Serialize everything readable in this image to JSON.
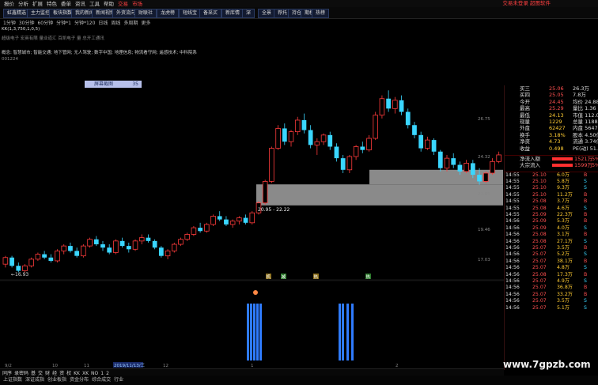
{
  "menu": {
    "items": [
      "报价",
      "分析",
      "扩展",
      "特色",
      "委单",
      "资讯",
      "工具",
      "帮助"
    ],
    "extra": [
      "交易",
      "市场"
    ],
    "right": "交易未登录 超图软件"
  },
  "toolbar": {
    "buttons": [
      "虹鑫精选",
      "主力监控",
      "板块指数",
      "我的新闻",
      "新闻视频",
      "外资流向",
      "财联社",
      "龙虎榜",
      "短线宝",
      "备采买",
      "新库情",
      "深",
      "全景",
      "荐托",
      "持仓",
      "期权",
      "热榜"
    ]
  },
  "tabs": {
    "items": [
      "1分钟",
      "30分钟",
      "60分钟",
      "分钟*1",
      "分钟*120",
      "日线",
      "周线",
      "多周期",
      "更多"
    ]
  },
  "info": {
    "line1": "KK(1,3,750,1,0,5)",
    "line2": "超级电子 宏英有限 量业道汇 百凯电子 量 总开工通讯",
    "line3": "概念: 智慧城市; 智能交通; 地下管网; 无人驾驶; 数字中国; 地理信息; 物流看守网; 遥感技术; 中科院系",
    "line4": "001224"
  },
  "badge": {
    "label": "屏幕截图",
    "value": "35"
  },
  "chart": {
    "annotations": {
      "low_label": "16.93",
      "range_label": "20.95 - 22.22"
    },
    "yaxis_right": [
      "26.75",
      "24.32",
      "21.89",
      "19.46",
      "17.03"
    ],
    "signals": [
      "机",
      "减",
      "热",
      "热"
    ],
    "volume_axis": [
      "75.00",
      "60.00",
      "45.00",
      "30.00",
      "15.00"
    ],
    "date_label": "2019/11/13/三",
    "ticks": [
      "9/2",
      "10",
      "11",
      "12",
      "1",
      "2"
    ]
  },
  "chart_data": {
    "type": "candlestick",
    "candles": [
      [
        17.4,
        17.9,
        17.2,
        17.8
      ],
      [
        17.8,
        17.9,
        17.2,
        17.3
      ],
      [
        17.3,
        17.5,
        16.9,
        17.0
      ],
      [
        17.0,
        17.4,
        16.9,
        17.3
      ],
      [
        17.3,
        17.8,
        17.2,
        17.7
      ],
      [
        17.7,
        18.1,
        17.6,
        18.0
      ],
      [
        18.0,
        18.2,
        17.7,
        17.8
      ],
      [
        17.8,
        18.0,
        17.5,
        17.6
      ],
      [
        17.6,
        18.3,
        17.5,
        18.2
      ],
      [
        18.2,
        18.6,
        18.0,
        18.5
      ],
      [
        18.5,
        18.7,
        18.1,
        18.2
      ],
      [
        18.2,
        18.4,
        17.8,
        17.9
      ],
      [
        17.9,
        18.6,
        17.8,
        18.5
      ],
      [
        18.5,
        19.0,
        18.4,
        18.9
      ],
      [
        18.9,
        19.1,
        18.5,
        18.6
      ],
      [
        18.6,
        18.8,
        18.2,
        18.4
      ],
      [
        18.4,
        18.6,
        18.0,
        18.1
      ],
      [
        18.1,
        18.9,
        18.0,
        18.8
      ],
      [
        18.8,
        19.0,
        18.4,
        18.5
      ],
      [
        18.5,
        18.7,
        18.1,
        18.3
      ],
      [
        18.3,
        18.9,
        18.2,
        18.8
      ],
      [
        18.8,
        19.2,
        18.6,
        19.0
      ],
      [
        19.0,
        19.2,
        18.7,
        18.8
      ],
      [
        18.8,
        18.9,
        18.3,
        18.4
      ],
      [
        18.4,
        18.5,
        17.8,
        17.9
      ],
      [
        17.9,
        18.3,
        17.7,
        18.2
      ],
      [
        18.2,
        18.7,
        18.1,
        18.6
      ],
      [
        18.6,
        19.0,
        18.5,
        18.9
      ],
      [
        18.9,
        19.3,
        18.8,
        19.2
      ],
      [
        19.2,
        19.7,
        19.1,
        19.6
      ],
      [
        19.6,
        19.9,
        19.3,
        19.4
      ],
      [
        19.4,
        19.9,
        19.3,
        19.8
      ],
      [
        19.8,
        20.4,
        19.7,
        20.3
      ],
      [
        20.3,
        20.6,
        20.0,
        20.1
      ],
      [
        20.1,
        20.3,
        19.7,
        19.8
      ],
      [
        19.8,
        20.1,
        19.6,
        20.0
      ],
      [
        20.0,
        20.3,
        19.8,
        20.2
      ],
      [
        20.2,
        20.4,
        19.8,
        19.9
      ],
      [
        19.9,
        20.6,
        19.8,
        20.5
      ],
      [
        20.5,
        21.2,
        20.4,
        21.1
      ],
      [
        21.1,
        22.5,
        21.0,
        22.4
      ],
      [
        22.4,
        24.5,
        22.3,
        24.4
      ],
      [
        24.4,
        25.8,
        24.3,
        25.6
      ],
      [
        25.6,
        25.9,
        24.6,
        24.8
      ],
      [
        24.8,
        25.5,
        24.5,
        25.4
      ],
      [
        25.4,
        26.3,
        25.2,
        26.1
      ],
      [
        26.1,
        26.5,
        25.3,
        25.5
      ],
      [
        25.5,
        25.8,
        24.4,
        24.6
      ],
      [
        24.6,
        25.0,
        24.0,
        24.8
      ],
      [
        24.8,
        25.3,
        24.6,
        25.2
      ],
      [
        25.2,
        25.4,
        24.3,
        24.5
      ],
      [
        24.5,
        24.7,
        23.6,
        23.8
      ],
      [
        23.8,
        24.0,
        22.9,
        23.1
      ],
      [
        23.1,
        24.0,
        22.9,
        23.9
      ],
      [
        23.9,
        24.6,
        23.7,
        24.5
      ],
      [
        24.5,
        24.8,
        24.1,
        24.3
      ],
      [
        24.3,
        25.2,
        24.2,
        25.0
      ],
      [
        25.0,
        26.6,
        24.9,
        26.4
      ],
      [
        26.4,
        27.6,
        26.2,
        27.4
      ],
      [
        27.4,
        27.9,
        26.6,
        26.8
      ],
      [
        26.8,
        27.5,
        26.5,
        27.3
      ],
      [
        27.3,
        27.6,
        26.4,
        26.6
      ],
      [
        26.6,
        26.8,
        25.6,
        25.8
      ],
      [
        25.8,
        26.0,
        25.0,
        25.2
      ],
      [
        25.2,
        25.4,
        24.2,
        24.4
      ],
      [
        24.4,
        25.1,
        24.3,
        24.9
      ],
      [
        24.9,
        25.0,
        24.0,
        24.2
      ],
      [
        24.2,
        24.3,
        23.0,
        23.2
      ],
      [
        23.2,
        24.0,
        23.0,
        23.8
      ],
      [
        23.8,
        24.1,
        23.2,
        23.4
      ],
      [
        23.4,
        23.6,
        22.8,
        23.0
      ],
      [
        23.0,
        23.7,
        22.9,
        23.5
      ],
      [
        23.5,
        23.7,
        22.6,
        22.8
      ],
      [
        22.8,
        23.2,
        22.2,
        22.4
      ],
      [
        22.4,
        23.0,
        22.3,
        22.9
      ],
      [
        22.9,
        23.8,
        22.8,
        23.6
      ],
      [
        23.6,
        24.2,
        23.5,
        24.0
      ]
    ],
    "yrange": [
      16.5,
      28.2
    ],
    "volume": [
      0,
      0,
      0,
      0,
      0,
      0,
      0,
      0,
      0,
      0,
      0,
      0,
      0,
      0,
      0,
      0,
      0,
      0,
      0,
      0,
      0,
      0,
      0,
      0,
      0,
      0,
      0,
      0,
      0,
      0,
      0,
      0,
      0,
      0,
      0,
      0,
      0,
      0,
      0,
      0,
      0,
      0,
      0,
      0,
      0,
      0,
      0,
      0,
      0,
      0,
      0,
      0,
      0,
      0,
      0,
      0,
      0,
      0,
      0,
      0,
      0,
      0,
      0,
      0,
      0,
      0,
      0,
      0,
      0,
      0,
      0,
      0,
      0,
      0,
      0,
      0,
      0
    ],
    "volume_bars_visible": [
      [
        312,
        316,
        320,
        324,
        328
      ],
      [
        428,
        432,
        438,
        444
      ]
    ]
  },
  "quote": {
    "rows": [
      [
        "买三",
        "25.06",
        "26.3万"
      ],
      [
        "买四",
        "25.05",
        "7.8万"
      ],
      [
        "今开",
        "24.45",
        "均价 24.88"
      ],
      [
        "最高",
        "25.29",
        "量比 1.36"
      ],
      [
        "最低",
        "24.13",
        "市值 112.0亿"
      ],
      [
        "现量",
        "1229",
        "总量 118898"
      ],
      [
        "外盘",
        "62427",
        "内盘 56471"
      ],
      [
        "换手",
        "3.18%",
        "股本 4.50亿"
      ],
      [
        "净资",
        "4.73",
        "流通 3.74亿"
      ],
      [
        "收益",
        "0.498",
        "PE(动) 51.1"
      ]
    ],
    "flow": [
      [
        "净流入额",
        "1521万",
        "5%"
      ],
      [
        "大宗流入",
        "1599万",
        "5%"
      ]
    ]
  },
  "ticks_list": [
    [
      "14:55",
      "25.10",
      "6.0万",
      "B"
    ],
    [
      "14:55",
      "25.10",
      "5.8万",
      "S"
    ],
    [
      "14:55",
      "25.10",
      "9.3万",
      "S"
    ],
    [
      "14:55",
      "25.10",
      "11.2万",
      "B"
    ],
    [
      "14:55",
      "25.08",
      "3.7万",
      "B"
    ],
    [
      "14:55",
      "25.08",
      "4.6万",
      "S"
    ],
    [
      "14:55",
      "25.09",
      "22.3万",
      "B"
    ],
    [
      "14:56",
      "25.09",
      "5.3万",
      "B"
    ],
    [
      "14:56",
      "25.09",
      "4.0万",
      "S"
    ],
    [
      "14:56",
      "25.08",
      "3.1万",
      "B"
    ],
    [
      "14:56",
      "25.08",
      "27.1万",
      "S"
    ],
    [
      "14:56",
      "25.07",
      "3.5万",
      "B"
    ],
    [
      "14:56",
      "25.07",
      "5.2万",
      "S"
    ],
    [
      "14:56",
      "25.07",
      "38.1万",
      "B"
    ],
    [
      "14:56",
      "25.07",
      "4.8万",
      "S"
    ],
    [
      "14:56",
      "25.08",
      "17.3万",
      "B"
    ],
    [
      "14:56",
      "25.07",
      "4.9万",
      "S"
    ],
    [
      "14:56",
      "25.07",
      "36.8万",
      "B"
    ],
    [
      "14:56",
      "25.07",
      "33.2万",
      "B"
    ],
    [
      "14:56",
      "25.07",
      "3.5万",
      "S"
    ],
    [
      "14:56",
      "25.07",
      "5.1万",
      "S"
    ]
  ],
  "bottom_tabs": [
    "同序",
    "录密码",
    "基",
    "交",
    "财",
    "经",
    "资",
    "权",
    "KK",
    "XK",
    "NO",
    "1",
    "2"
  ],
  "status": [
    "上证指数",
    "深证成指",
    "创业板指",
    "资金分布",
    "综合成交",
    "行业"
  ],
  "watermark": "www.7gpzb.com",
  "colors": {
    "up": "#ff3b3b",
    "down": "#3ad6ff",
    "vol": "#2f7bff",
    "gray": "#8a8a8a",
    "bg": "#000000"
  }
}
